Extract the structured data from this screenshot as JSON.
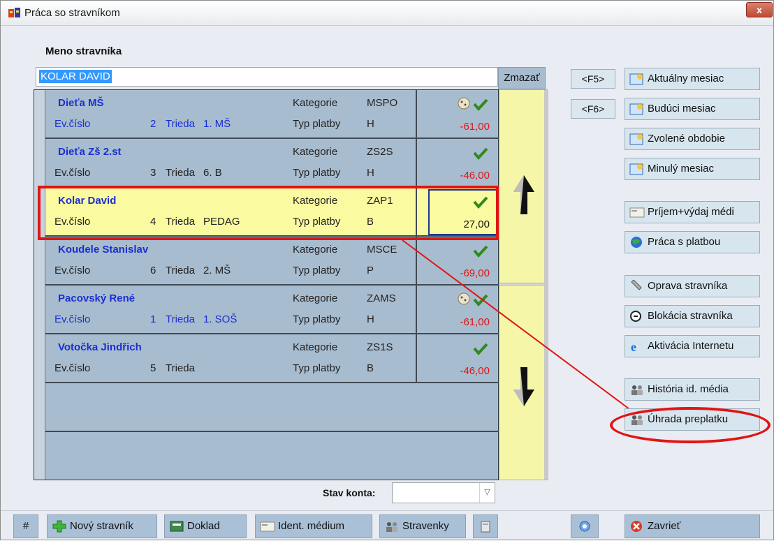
{
  "window": {
    "title": "Práca so stravníkom",
    "close_label": "x"
  },
  "search": {
    "label": "Meno stravníka",
    "value": "KOLAR DAVID",
    "clear_label": "Zmazať"
  },
  "labels": {
    "ev": "Ev.číslo",
    "trieda": "Trieda",
    "kategorie": "Kategorie",
    "typ_platby": "Typ platby"
  },
  "rows": [
    {
      "name": "Dieťa MŠ",
      "ev_num": "2",
      "trieda": "1. MŠ",
      "kategorie": "MSPO",
      "typ_platby": "H",
      "amount": "-61,00",
      "icons": [
        "cookie-icon",
        "check-icon"
      ]
    },
    {
      "name": "Dieťa Zš 2.st",
      "ev_num": "3",
      "trieda": "6. B",
      "kategorie": "ZS2S",
      "typ_platby": "H",
      "amount": "-46,00",
      "icons": [
        "check-icon"
      ]
    },
    {
      "name": "Kolar David",
      "ev_num": "4",
      "trieda": "PEDAG",
      "kategorie": "ZAP1",
      "typ_platby": "B",
      "amount": "27,00",
      "icons": [
        "check-icon"
      ]
    },
    {
      "name": "Koudele Stanislav",
      "ev_num": "6",
      "trieda": "2. MŠ",
      "kategorie": "MSCE",
      "typ_platby": "P",
      "amount": "-69,00",
      "icons": [
        "check-icon"
      ]
    },
    {
      "name": "Pacovský René",
      "ev_num": "1",
      "trieda": "1. SOŠ",
      "kategorie": "ZAMS",
      "typ_platby": "H",
      "amount": "-61,00",
      "icons": [
        "cookie-icon",
        "check-icon"
      ]
    },
    {
      "name": "Votočka Jindřich",
      "ev_num": "5",
      "trieda": "",
      "kategorie": "ZS1S",
      "typ_platby": "B",
      "amount": "-46,00",
      "icons": [
        "check-icon"
      ]
    }
  ],
  "selected_row": "Kolar David",
  "stav_konta": {
    "label": "Stav konta:",
    "value": ""
  },
  "fkeys": {
    "f5": "<F5>",
    "f6": "<F6>"
  },
  "right_buttons": {
    "aktualny": "Aktuálny mesiac",
    "buduci": "Budúci mesiac",
    "zvolene": "Zvolené obdobie",
    "minuly": "Minulý mesiac",
    "prijem": "Príjem+výdaj médi",
    "praca_platbou": "Práca s platbou",
    "oprava": "Oprava stravníka",
    "blokacia": "Blokácia stravníka",
    "aktivacia": "Aktivácia Internetu",
    "historia": "História id. média",
    "uhrada": "Úhrada preplatku"
  },
  "bottom": {
    "hash": "#",
    "novy": "Nový stravník",
    "doklad": "Doklad",
    "ident": "Ident. médium",
    "stravenky": "Stravenky",
    "zavriet": "Zavrieť"
  },
  "colors": {
    "highlight": "#e01515",
    "selected_row_bg": "#fafaa0",
    "list_bg": "#a8bccf",
    "link_blue": "#1a2fd0",
    "negative": "#e01515"
  }
}
